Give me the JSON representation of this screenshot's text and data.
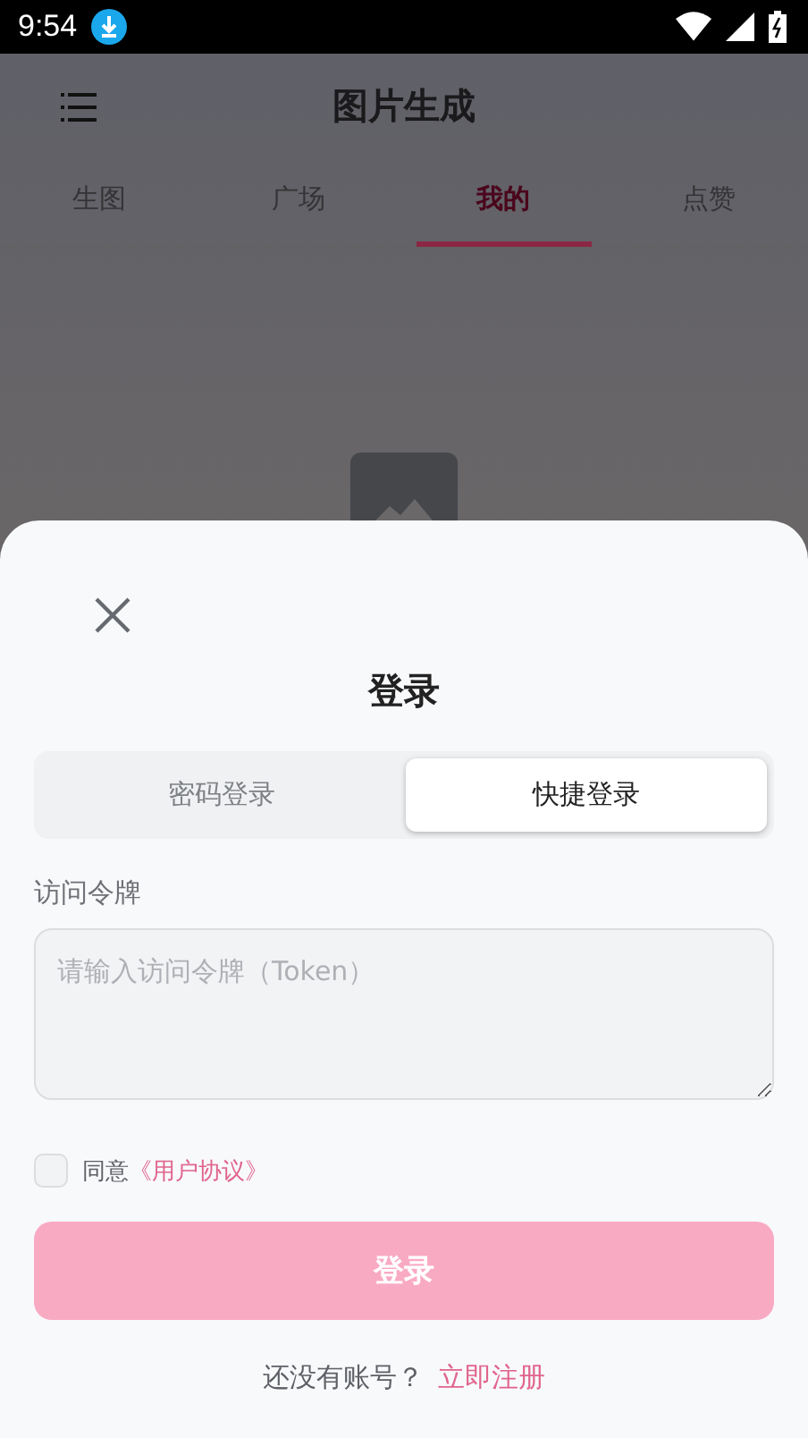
{
  "status_bar": {
    "time": "9:54"
  },
  "header": {
    "title": "图片生成"
  },
  "tabs": [
    {
      "label": "生图",
      "selected": false
    },
    {
      "label": "广场",
      "selected": false
    },
    {
      "label": "我的",
      "selected": true
    },
    {
      "label": "点赞",
      "selected": false
    }
  ],
  "login_sheet": {
    "title": "登录",
    "modes": [
      {
        "label": "密码登录",
        "selected": false
      },
      {
        "label": "快捷登录",
        "selected": true
      }
    ],
    "token_field": {
      "label": "访问令牌",
      "placeholder": "请输入访问令牌（Token）"
    },
    "agreement": {
      "checked": false,
      "text": "同意",
      "link": "《用户协议》"
    },
    "submit_button": {
      "label": "登录"
    },
    "footer": {
      "text": "还没有账号？",
      "link": "立即注册"
    }
  }
}
